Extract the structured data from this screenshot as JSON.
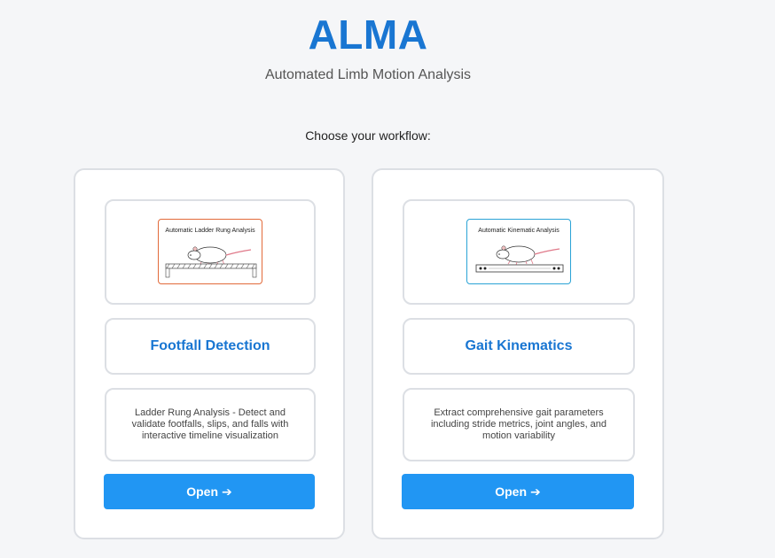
{
  "app": {
    "title": "ALMA",
    "subtitle": "Automated Limb Motion Analysis",
    "prompt": "Choose your workflow:"
  },
  "workflows": [
    {
      "thumbnail_caption": "Automatic Ladder Rung Analysis",
      "thumbnail_border_color": "#e26a3a",
      "title": "Footfall Detection",
      "description": "Ladder Rung Analysis - Detect and validate footfalls, slips, and falls with interactive timeline visualization",
      "button_label": "Open",
      "button_icon": "arrow-right-icon"
    },
    {
      "thumbnail_caption": "Automatic Kinematic Analysis",
      "thumbnail_border_color": "#2aa3d6",
      "title": "Gait Kinematics",
      "description": "Extract comprehensive gait parameters including stride metrics, joint angles, and motion variability",
      "button_label": "Open",
      "button_icon": "arrow-right-icon"
    }
  ],
  "colors": {
    "accent": "#1976d2",
    "button": "#2196f3",
    "card_border": "#dcdfe4",
    "background": "#f5f6f8"
  }
}
